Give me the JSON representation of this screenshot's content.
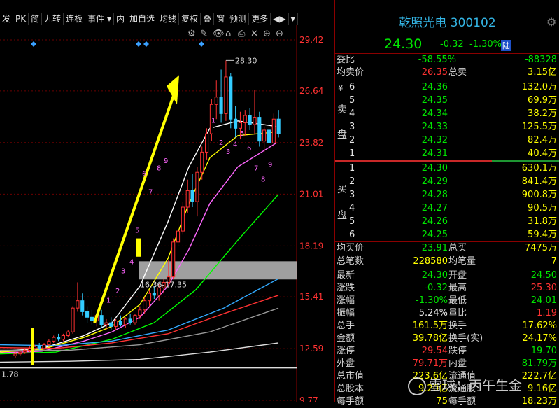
{
  "toolbar": {
    "items": [
      "发",
      "PK",
      "简",
      "九转",
      "连板",
      "事件 ▾",
      "内",
      "加自选",
      "均线",
      "复权",
      "叠",
      "窗",
      "预测",
      "更多",
      "◀▶",
      "▾"
    ],
    "chart_tools": [
      "⚙",
      "✎",
      "👁",
      "⌂",
      "⎙",
      "✕",
      "⊕",
      "⊖"
    ]
  },
  "y_axis": {
    "ticks": [
      "29.42",
      "26.64",
      "23.82",
      "21.01",
      "18.19",
      "15.41",
      "12.59",
      "9.77"
    ]
  },
  "annotations": {
    "high_label": "28.30",
    "gap_label": "16.36-17.35",
    "left_low": "1.78",
    "tick_numbers_up": [
      "1",
      "2",
      "3",
      "4",
      "5",
      "6",
      "7",
      "8",
      "9"
    ],
    "tick_numbers_down": [
      "1",
      "2",
      "3",
      "4",
      "5",
      "6",
      "7",
      "8",
      "9"
    ]
  },
  "chart_data": {
    "type": "candlestick",
    "ylim": [
      9.77,
      29.42
    ],
    "candles": [
      [
        12.2,
        12.4,
        12.1,
        12.3
      ],
      [
        12.3,
        12.5,
        12.2,
        12.4
      ],
      [
        12.4,
        12.6,
        12.3,
        12.5
      ],
      [
        12.5,
        12.7,
        12.4,
        12.6
      ],
      [
        12.6,
        12.8,
        12.5,
        12.7
      ],
      [
        12.7,
        12.9,
        12.5,
        12.6
      ],
      [
        12.6,
        12.9,
        12.5,
        12.8
      ],
      [
        12.8,
        13.1,
        12.7,
        13.0
      ],
      [
        13.0,
        13.3,
        12.9,
        13.2
      ],
      [
        13.2,
        13.4,
        13.0,
        13.1
      ],
      [
        13.1,
        13.4,
        13.0,
        13.3
      ],
      [
        13.3,
        13.6,
        13.2,
        13.5
      ],
      [
        13.5,
        14.9,
        13.4,
        14.8
      ],
      [
        14.8,
        16.2,
        14.6,
        15.2
      ],
      [
        15.2,
        15.6,
        14.4,
        14.6
      ],
      [
        14.6,
        14.9,
        14.0,
        14.3
      ],
      [
        14.3,
        14.7,
        13.9,
        14.1
      ],
      [
        14.1,
        14.5,
        13.8,
        14.4
      ],
      [
        14.4,
        14.7,
        13.7,
        13.9
      ],
      [
        13.9,
        14.2,
        13.6,
        14.0
      ],
      [
        14.0,
        14.3,
        13.6,
        13.8
      ],
      [
        13.8,
        14.2,
        13.6,
        14.1
      ],
      [
        14.1,
        14.4,
        13.8,
        13.9
      ],
      [
        13.9,
        14.3,
        13.7,
        14.2
      ],
      [
        14.2,
        14.5,
        13.9,
        14.0
      ],
      [
        14.0,
        14.5,
        13.9,
        14.4
      ],
      [
        14.4,
        14.9,
        14.2,
        14.7
      ],
      [
        14.7,
        15.4,
        14.5,
        15.2
      ],
      [
        15.2,
        15.8,
        14.9,
        15.6
      ],
      [
        15.6,
        16.0,
        15.3,
        15.5
      ],
      [
        15.5,
        16.1,
        15.2,
        15.9
      ],
      [
        15.9,
        16.4,
        15.6,
        16.2
      ],
      [
        16.2,
        17.4,
        16.0,
        16.5
      ],
      [
        16.5,
        18.6,
        16.4,
        18.4
      ],
      [
        18.4,
        19.6,
        18.2,
        19.0
      ],
      [
        19.0,
        20.6,
        18.8,
        20.3
      ],
      [
        20.3,
        21.8,
        20.0,
        21.2
      ],
      [
        21.2,
        22.1,
        20.3,
        20.6
      ],
      [
        20.6,
        22.5,
        19.8,
        22.2
      ],
      [
        22.2,
        23.6,
        21.8,
        23.3
      ],
      [
        23.3,
        24.6,
        22.9,
        24.3
      ],
      [
        24.3,
        26.2,
        23.9,
        25.9
      ],
      [
        25.9,
        27.2,
        25.1,
        26.3
      ],
      [
        26.3,
        27.8,
        24.9,
        25.4
      ],
      [
        25.4,
        28.3,
        25.0,
        27.4
      ],
      [
        27.4,
        27.6,
        24.6,
        25.1
      ],
      [
        25.1,
        25.8,
        24.1,
        24.6
      ],
      [
        24.6,
        25.5,
        24.0,
        24.9
      ],
      [
        24.9,
        25.6,
        24.2,
        25.3
      ],
      [
        25.3,
        25.7,
        24.5,
        24.8
      ],
      [
        24.8,
        26.7,
        24.3,
        25.2
      ],
      [
        25.2,
        25.5,
        23.6,
        23.9
      ],
      [
        23.9,
        24.7,
        23.3,
        24.5
      ],
      [
        24.5,
        25.1,
        23.6,
        23.8
      ],
      [
        23.8,
        25.4,
        23.6,
        25.1
      ],
      [
        25.1,
        25.6,
        24.1,
        24.3
      ]
    ]
  },
  "panel": {
    "name": "乾照光电",
    "code": "300102",
    "price": "24.30",
    "change": "-0.32",
    "pct": "-1.30%",
    "flag": "陆",
    "weibi": {
      "label": "委比",
      "v1": "-58.55%",
      "v2": "-88328"
    },
    "avg_sell": {
      "label": "均卖价",
      "price": "26.35",
      "label2": "总卖",
      "value": "3.15亿"
    },
    "sell_label": {
      "a": "¥",
      "b": "卖",
      "c": "盘"
    },
    "sells": [
      {
        "n": "6",
        "p": "24.36",
        "v": "132.0万"
      },
      {
        "n": "5",
        "p": "24.35",
        "v": "69.9万"
      },
      {
        "n": "4",
        "p": "24.34",
        "v": "38.2万"
      },
      {
        "n": "3",
        "p": "24.33",
        "v": "125.5万"
      },
      {
        "n": "2",
        "p": "24.32",
        "v": "82.4万"
      },
      {
        "n": "1",
        "p": "24.31",
        "v": "40.4万"
      }
    ],
    "buy_label": {
      "b": "买",
      "c": "盘"
    },
    "buys": [
      {
        "n": "1",
        "p": "24.30",
        "v": "630.1万"
      },
      {
        "n": "2",
        "p": "24.29",
        "v": "841.4万"
      },
      {
        "n": "3",
        "p": "24.28",
        "v": "900.8万"
      },
      {
        "n": "4",
        "p": "24.27",
        "v": "90.5万"
      },
      {
        "n": "5",
        "p": "24.26",
        "v": "31.8万"
      },
      {
        "n": "6",
        "p": "24.25",
        "v": "59.4万"
      }
    ],
    "avg_buy": {
      "label": "均买价",
      "price": "23.91",
      "label2": "总买",
      "value": "7475万"
    },
    "trades": {
      "label": "总笔数",
      "value": "228580",
      "label2": "均笔量",
      "value2": "7"
    },
    "stats": [
      {
        "l1": "最新",
        "v1": "24.30",
        "c1": "g",
        "l2": "开盘",
        "v2": "24.50",
        "c2": "g"
      },
      {
        "l1": "涨跌",
        "v1": "-0.32",
        "c1": "g",
        "l2": "最高",
        "v2": "25.30",
        "c2": "r"
      },
      {
        "l1": "涨幅",
        "v1": "-1.30%",
        "c1": "g",
        "l2": "最低",
        "v2": "24.01",
        "c2": "g"
      },
      {
        "l1": "振幅",
        "v1": "5.24%",
        "c1": "w",
        "l2": "量比",
        "v2": "1.19",
        "c2": "r"
      },
      {
        "l1": "总手",
        "v1": "161.5万",
        "c1": "y",
        "l2": "换手",
        "v2": "17.62%",
        "c2": "y"
      },
      {
        "l1": "金额",
        "v1": "39.78亿",
        "c1": "y",
        "l2": "换手(实)",
        "v2": "24.17%",
        "c2": "y"
      },
      {
        "l1": "涨停",
        "v1": "29.54",
        "c1": "r",
        "l2": "跌停",
        "v2": "19.70",
        "c2": "g"
      },
      {
        "l1": "外盘",
        "v1": "79.71万",
        "c1": "r",
        "l2": "内盘",
        "v2": "81.79万",
        "c2": "g"
      },
      {
        "l1": "总市值",
        "v1": "223.6亿",
        "c1": "y",
        "l2": "流通值",
        "v2": "222.7亿",
        "c2": "y"
      },
      {
        "l1": "总股本",
        "v1": "9.20亿",
        "c1": "y",
        "l2": "流通股",
        "v2": "9.16亿",
        "c2": "y"
      },
      {
        "l1": "每手额",
        "v1": "75",
        "c1": "y",
        "l2": "每手额",
        "v2": "18.23万",
        "c2": "y"
      }
    ],
    "watermark": "雪球：丙午生金"
  }
}
